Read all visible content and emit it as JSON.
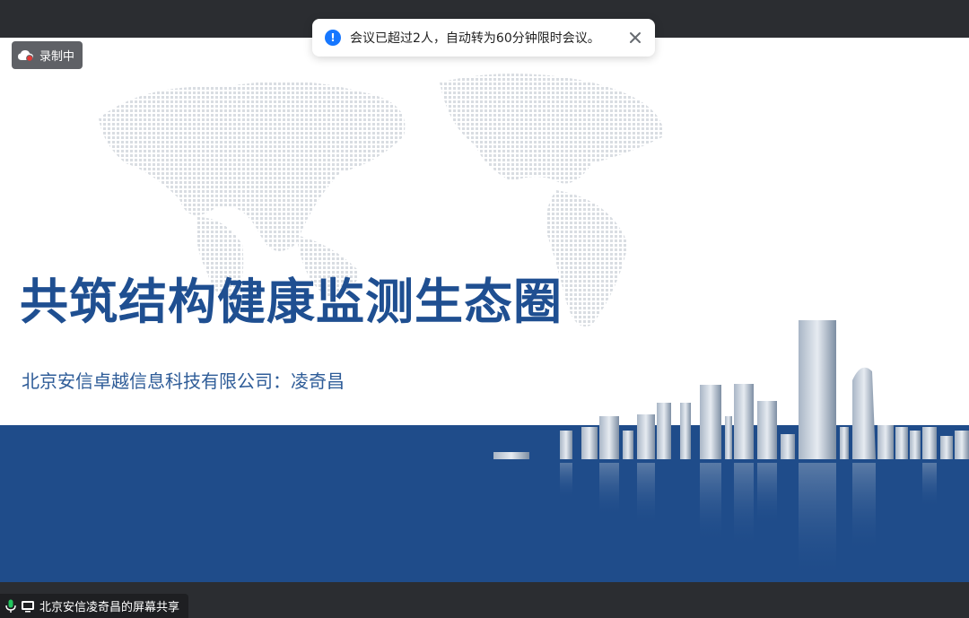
{
  "recording": {
    "label": "录制中"
  },
  "notification": {
    "message": "会议已超过2人，自动转为60分钟限时会议。",
    "icon": "info-icon",
    "close_icon": "close-icon",
    "accent": "#1677ff"
  },
  "slide": {
    "title": "共筑结构健康监测生态圈",
    "subtitle": "北京安信卓越信息科技有限公司：凌奇昌",
    "title_color": "#1f4f91",
    "band_color": "#1f4c8a"
  },
  "share": {
    "label": "北京安信凌奇昌的屏幕共享",
    "mic_icon": "microphone-icon",
    "screen_icon": "screen-share-icon"
  }
}
